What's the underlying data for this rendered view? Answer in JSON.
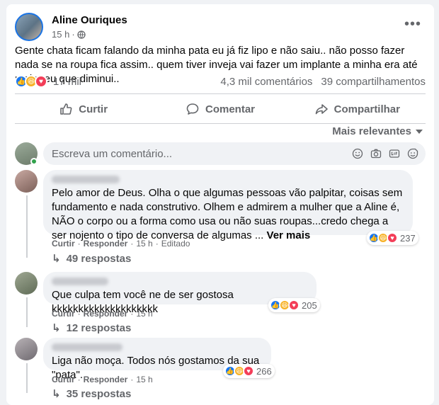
{
  "post": {
    "author": "Aline Ouriques",
    "time": "15 h",
    "text": "Gente chata ficam falando da minha pata eu já fiz lipo e não saiu.. não posso fazer nada se na roupa fica assim.. quem tiver inveja vai fazer um implante a minha era até maior eu que diminui..",
    "reaction_count": "17 mil",
    "comments_count": "4,3 mil comentários",
    "shares_count": "39 compartilhamentos",
    "reaction_icons": [
      "like-icon",
      "haha-icon",
      "love-icon"
    ]
  },
  "actions": {
    "like": "Curtir",
    "comment": "Comentar",
    "share": "Compartilhar"
  },
  "sort_label": "Mais relevantes",
  "composer": {
    "placeholder": "Escreva um comentário..."
  },
  "comments": [
    {
      "text": "Pelo amor de Deus. Olha o que algumas pessoas vão palpitar, coisas sem fundamento e nada construtivo. Olhem e admirem a mulher que a Aline é, NÃO o corpo ou a forma como usa ou não suas roupas...credo chega a ser nojento o tipo de conversa de algumas ...",
      "see_more": "Ver mais",
      "reactions": "237",
      "like": "Curtir",
      "reply": "Responder",
      "time": "15 h",
      "edited": "Editado",
      "replies": "49 respostas"
    },
    {
      "text": "Que culpa tem você ne de ser gostosa kkkkkkkkkkkkkkkkkkkk",
      "reactions": "205",
      "like": "Curtir",
      "reply": "Responder",
      "time": "15 h",
      "replies": "12 respostas"
    },
    {
      "text": "Liga não moça. Todos nós gostamos da sua \"pata\".",
      "reactions": "266",
      "like": "Curtir",
      "reply": "Responder",
      "time": "15 h",
      "replies": "35 respostas"
    }
  ],
  "colors": {
    "accent": "#1877f2",
    "secondary_text": "#65676b",
    "bubble": "#f0f2f5",
    "love": "#f33e58",
    "haha": "#f7b125"
  }
}
